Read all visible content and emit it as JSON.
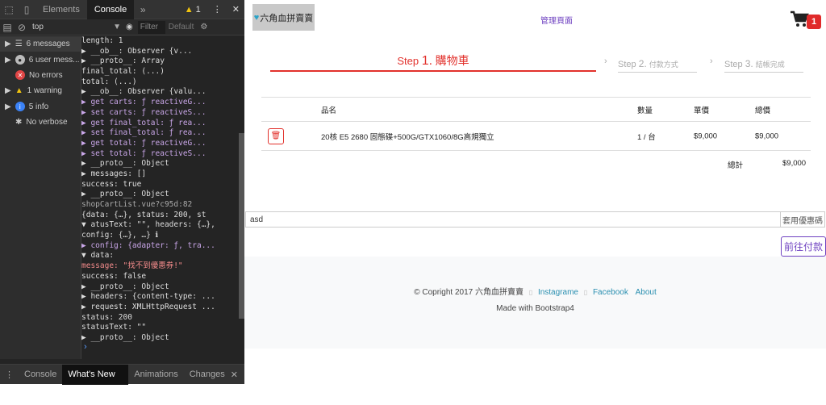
{
  "devtools": {
    "tabs": [
      "Elements",
      "Console"
    ],
    "warning_count": "1",
    "context": "top",
    "filter_placeholder": "Filter",
    "levels": "Default",
    "sidebar": [
      {
        "icon": "list-icon",
        "label": "6 messages"
      },
      {
        "icon": "user-icon",
        "label": "6 user mess..."
      },
      {
        "icon": "error-icon",
        "label": "No errors"
      },
      {
        "icon": "warning-icon",
        "label": "1 warning"
      },
      {
        "icon": "info-icon",
        "label": "5 info"
      },
      {
        "icon": "bug-icon",
        "label": "No verbose"
      }
    ],
    "console_lines": [
      "        length: 1",
      "      ▶ __ob__: Observer {v...",
      "      ▶ __proto__: Array",
      "     final_total: (...)",
      "     total: (...)",
      "   ▶ __ob__: Observer {valu...",
      "   ▶ get carts: ƒ reactiveG...",
      "   ▶ set carts: ƒ reactiveS...",
      "   ▶ get final_total: ƒ rea...",
      "   ▶ set final_total: ƒ rea...",
      "   ▶ get total: ƒ reactiveG...",
      "   ▶ set total: ƒ reactiveS...",
      "   ▶ __proto__: Object",
      " ▶ messages: []",
      "   success: true",
      " ▶ __proto__: Object",
      "          shopCartList.vue?c95d:82",
      " {data: {…}, status: 200, st",
      "▼ atusText: \"\", headers: {…},",
      "  config: {…}, …} ℹ",
      " ▶ config: {adapter: ƒ, tra...",
      " ▼ data:",
      "     message: \"找不到優惠券!\"",
      "     success: false",
      "   ▶ __proto__: Object",
      " ▶ headers: {content-type: ...",
      " ▶ request: XMLHttpRequest ...",
      "   status: 200",
      "   statusText: \"\"",
      " ▶ __proto__: Object"
    ],
    "bottom_tabs": [
      "Console",
      "What's New",
      "Animations",
      "Changes"
    ]
  },
  "site": {
    "brand": "六角血拼賣賣",
    "admin_link": "管理頁面",
    "cart_count": "1",
    "steps": [
      {
        "prefix": "Step",
        "num": "1.",
        "label": "購物車"
      },
      {
        "prefix": "Step",
        "num": "2.",
        "label": "付款方式"
      },
      {
        "prefix": "Step",
        "num": "3.",
        "label": "結帳完成"
      }
    ],
    "table": {
      "headers": [
        "品名",
        "數量",
        "單價",
        "總價"
      ],
      "rows": [
        {
          "name": "20核 E5 2680 固態碟+500G/GTX1060/8G高規獨立",
          "qty": "1 / 台",
          "price": "$9,000",
          "total": "$9,000"
        }
      ],
      "sum_label": "總計",
      "sum_value": "$9,000"
    },
    "coupon": {
      "value": "asd",
      "button": "套用優惠碼"
    },
    "pay_button": "前往付款",
    "footer": {
      "copyright": "© Copright 2017 六角血拼賣賣",
      "links": [
        "Instagrame",
        "Facebook",
        "About"
      ],
      "made_with": "Made with Bootstrap4"
    }
  }
}
